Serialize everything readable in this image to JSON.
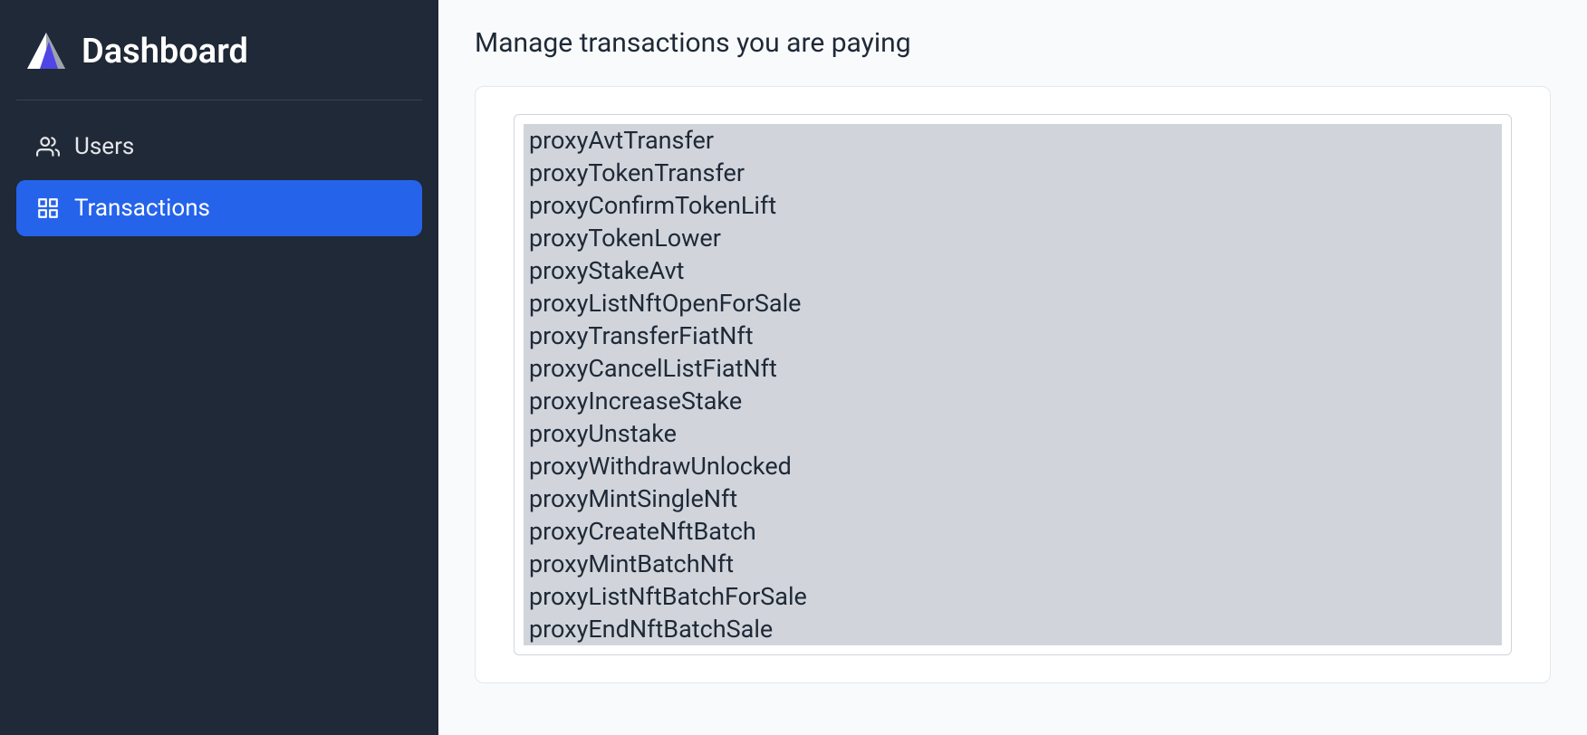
{
  "brand": {
    "title": "Dashboard"
  },
  "sidebar": {
    "items": [
      {
        "label": "Users",
        "active": false,
        "icon": "users-icon"
      },
      {
        "label": "Transactions",
        "active": true,
        "icon": "grid-icon"
      }
    ]
  },
  "page": {
    "title": "Manage transactions you are paying"
  },
  "transactions": {
    "options": [
      "proxyAvtTransfer",
      "proxyTokenTransfer",
      "proxyConfirmTokenLift",
      "proxyTokenLower",
      "proxyStakeAvt",
      "proxyListNftOpenForSale",
      "proxyTransferFiatNft",
      "proxyCancelListFiatNft",
      "proxyIncreaseStake",
      "proxyUnstake",
      "proxyWithdrawUnlocked",
      "proxyMintSingleNft",
      "proxyCreateNftBatch",
      "proxyMintBatchNft",
      "proxyListNftBatchForSale",
      "proxyEndNftBatchSale"
    ]
  }
}
